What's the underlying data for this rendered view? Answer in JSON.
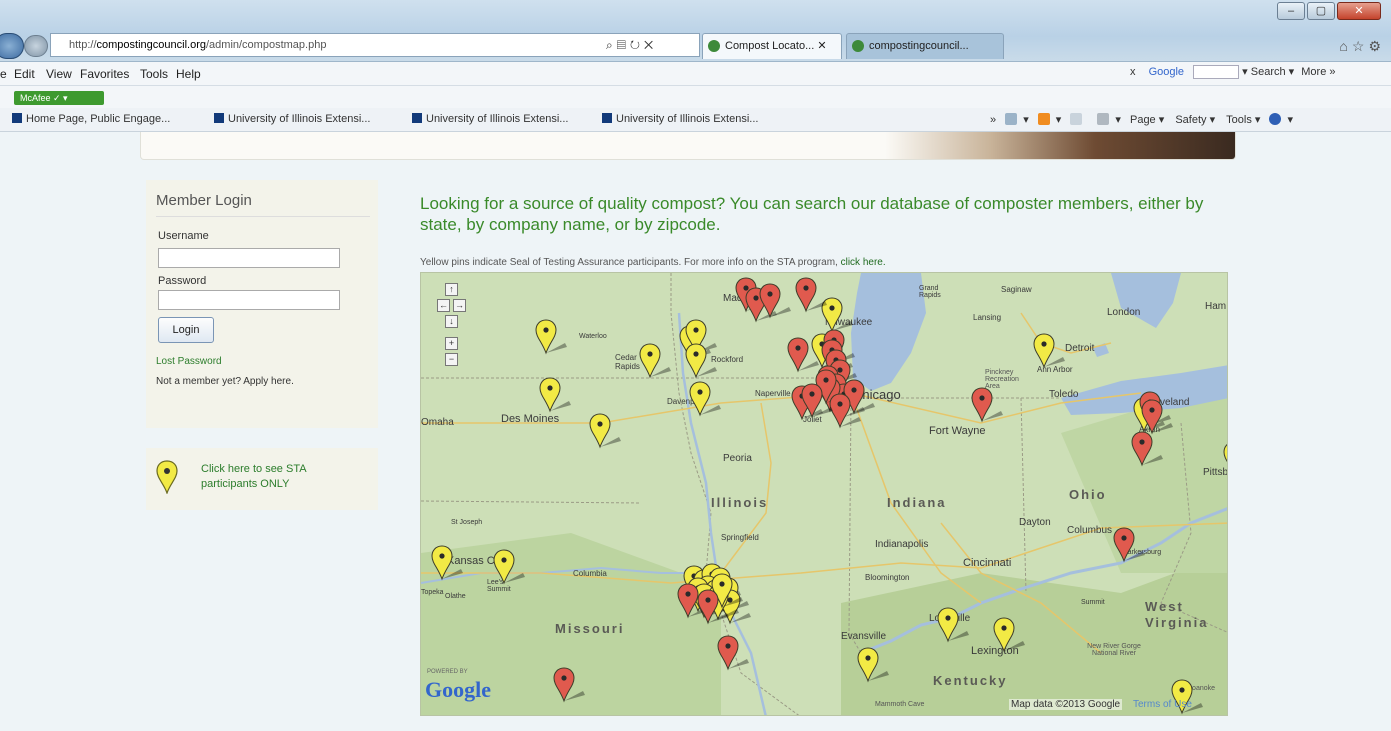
{
  "browser": {
    "address": {
      "prefix": "http://",
      "host": "compostingcouncil.org",
      "path": "/admin/compostmap.php"
    },
    "tabs": [
      {
        "label": "Compost Locato... ✕",
        "active": true
      },
      {
        "label": "compostingcouncil...",
        "active": false
      }
    ],
    "window_controls": [
      "–",
      "▢",
      "✕"
    ],
    "menu": [
      "e",
      "Edit",
      "View",
      "Favorites",
      "Tools",
      "Help"
    ],
    "search": {
      "provider": "Google",
      "button": "Search",
      "more": "More »",
      "close": "x"
    },
    "addon": "McAfee",
    "favorites": [
      "Home Page, Public Engage...",
      "University of Illinois Extensi...",
      "University of Illinois Extensi...",
      "University of Illinois Extensi..."
    ],
    "commands": {
      "page": "Page ▾",
      "safety": "Safety ▾",
      "tools": "Tools ▾"
    },
    "colors": {
      "chrome": "#b9d1e6",
      "close": "#c4432c"
    }
  },
  "login": {
    "title": "Member Login",
    "username_label": "Username",
    "password_label": "Password",
    "username_value": "",
    "password_value": "",
    "button": "Login",
    "lost_password": "Lost Password",
    "apply": "Not a member yet? Apply here."
  },
  "sta_filter": {
    "text": "Click here to see STA participants ONLY",
    "icon": "yellow-pin-icon"
  },
  "intro": "Looking for a source of quality compost? You can search our database of composter members, either by state, by company name, or by zipcode.",
  "caption": {
    "text": "Yellow pins indicate Seal of Testing Assurance participants. For more info on the STA program, ",
    "link": "click here."
  },
  "map": {
    "states": [
      "Illinois",
      "Indiana",
      "Ohio",
      "Missouri",
      "Kentucky",
      "West Virginia"
    ],
    "cities": [
      "Des Moines",
      "Peoria",
      "Springfield",
      "Chicago",
      "Fort Wayne",
      "Indianapolis",
      "Cincinnati",
      "Dayton",
      "Columbus",
      "Toledo",
      "Detroit",
      "London",
      "Lansing",
      "Grand Rapids",
      "Saginaw",
      "Ann Arbor",
      "Rockford",
      "Waterloo",
      "Cedar Rapids",
      "Davenport",
      "Naperville",
      "Joliet",
      "Kansas City",
      "Columbia",
      "Bloomington",
      "Louisville",
      "Lexington",
      "Evansville",
      "St Joseph",
      "Lee's Summit",
      "Topeka",
      "Olathe",
      "Parkersburg",
      "Pittsburgh",
      "Milwaukee",
      "Madison",
      "Cleveland",
      "Akron",
      "Omaha",
      "Ham",
      "Summit"
    ],
    "small_labels": [
      "Mammoth Cave",
      "New River Gorge National River",
      "Roanoke",
      "Pinckney Recreation Area"
    ],
    "credit": "Map data ©2013 Google",
    "terms": "Terms of Use",
    "logo": "Google",
    "logo_small": "POWERED BY",
    "zoom_controls": [
      "↑",
      "←",
      "→",
      "↓",
      "+",
      "−"
    ],
    "pin_colors": {
      "sta": "#f2ea45",
      "member": "#e05a4e"
    },
    "pin_counts": {
      "yellow": 31,
      "red": 27
    }
  }
}
